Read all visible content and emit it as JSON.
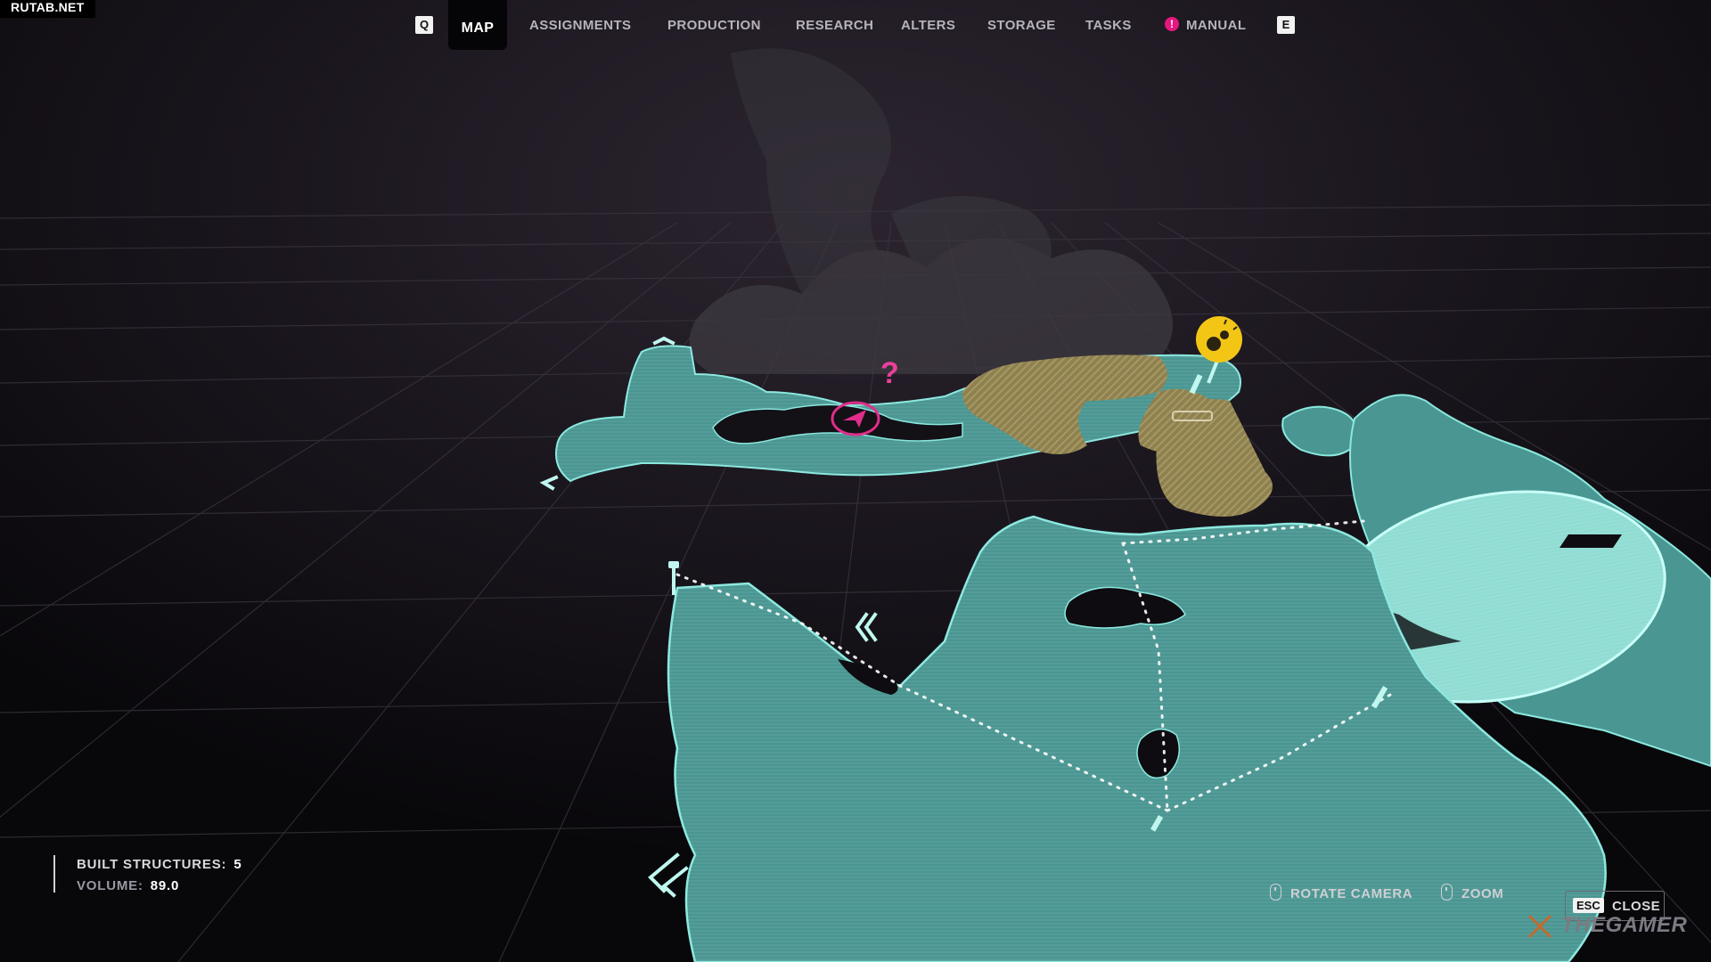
{
  "watermark": "RUTAB.NET",
  "nav": {
    "prev_key": "Q",
    "next_key": "E",
    "tabs": [
      {
        "label": "MAP",
        "active": true
      },
      {
        "label": "ASSIGNMENTS"
      },
      {
        "label": "PRODUCTION"
      },
      {
        "label": "RESEARCH"
      },
      {
        "label": "ALTERS"
      },
      {
        "label": "STORAGE"
      },
      {
        "label": "TASKS"
      },
      {
        "label": "MANUAL",
        "alert": "!"
      }
    ]
  },
  "map": {
    "unknown_marker": "?",
    "colors": {
      "land": "#4c9a96",
      "land_edge": "#8be8df",
      "sand": "#9a8a4f",
      "highlight": "#9fe7dc",
      "player": "#e02d8a",
      "objective": "#f3c616"
    },
    "icons": [
      "player-arrow-icon",
      "question-mark-icon",
      "objective-marker-icon",
      "chevron-waypoint-icon"
    ]
  },
  "stats": {
    "built_label": "BUILT STRUCTURES:",
    "built_value": "5",
    "volume_label": "VOLUME:",
    "volume_value": "89.0"
  },
  "controls": {
    "rotate": "ROTATE CAMERA",
    "zoom": "ZOOM",
    "esc_key": "ESC",
    "close": "CLOSE"
  },
  "brand": "THEGAMER"
}
